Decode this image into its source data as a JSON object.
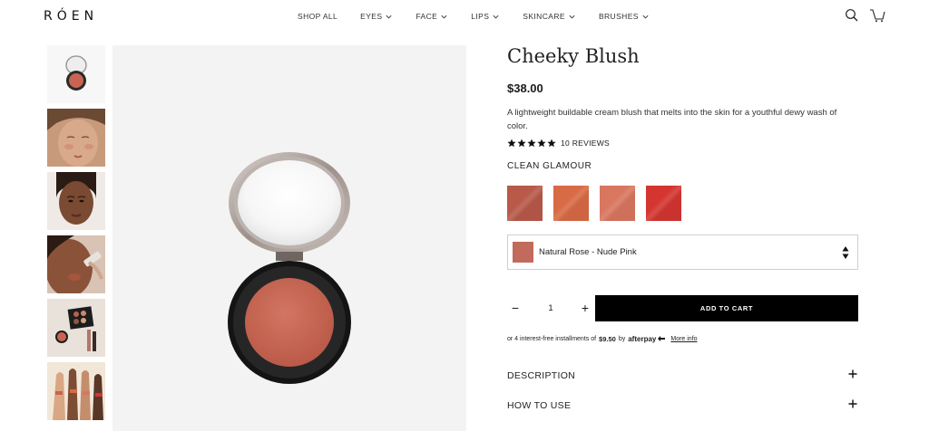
{
  "header": {
    "logo": "RÓEN",
    "nav": [
      {
        "label": "SHOP ALL",
        "has_menu": false
      },
      {
        "label": "EYES",
        "has_menu": true
      },
      {
        "label": "FACE",
        "has_menu": true
      },
      {
        "label": "LIPS",
        "has_menu": true
      },
      {
        "label": "SKINCARE",
        "has_menu": true
      },
      {
        "label": "BRUSHES",
        "has_menu": true
      }
    ],
    "icons": [
      "search-icon",
      "cart-icon"
    ]
  },
  "product": {
    "title": "Cheeky Blush",
    "price": "$38.00",
    "description": "A lightweight buildable cream blush that melts into the skin for a youthful dewy wash of color.",
    "rating": 5,
    "reviews_label": "10 REVIEWS",
    "collection": "CLEAN GLAMOUR",
    "swatches": [
      {
        "color": "#b8594a"
      },
      {
        "color": "#d86a45"
      },
      {
        "color": "#d9765f"
      },
      {
        "color": "#d43530"
      }
    ],
    "selected_shade": "Natural Rose - Nude Pink",
    "selected_color": "#c26a5b",
    "quantity": "1",
    "add_to_cart": "ADD TO CART",
    "afterpay": {
      "prefix": "or 4 interest-free installments of",
      "amount": "$9.50",
      "by": "by",
      "brand": "afterpay",
      "more": "More info"
    },
    "accordions": [
      {
        "label": "DESCRIPTION"
      },
      {
        "label": "HOW TO USE"
      }
    ]
  },
  "colors": {
    "accent": "#000000",
    "blush": "#c76552"
  }
}
